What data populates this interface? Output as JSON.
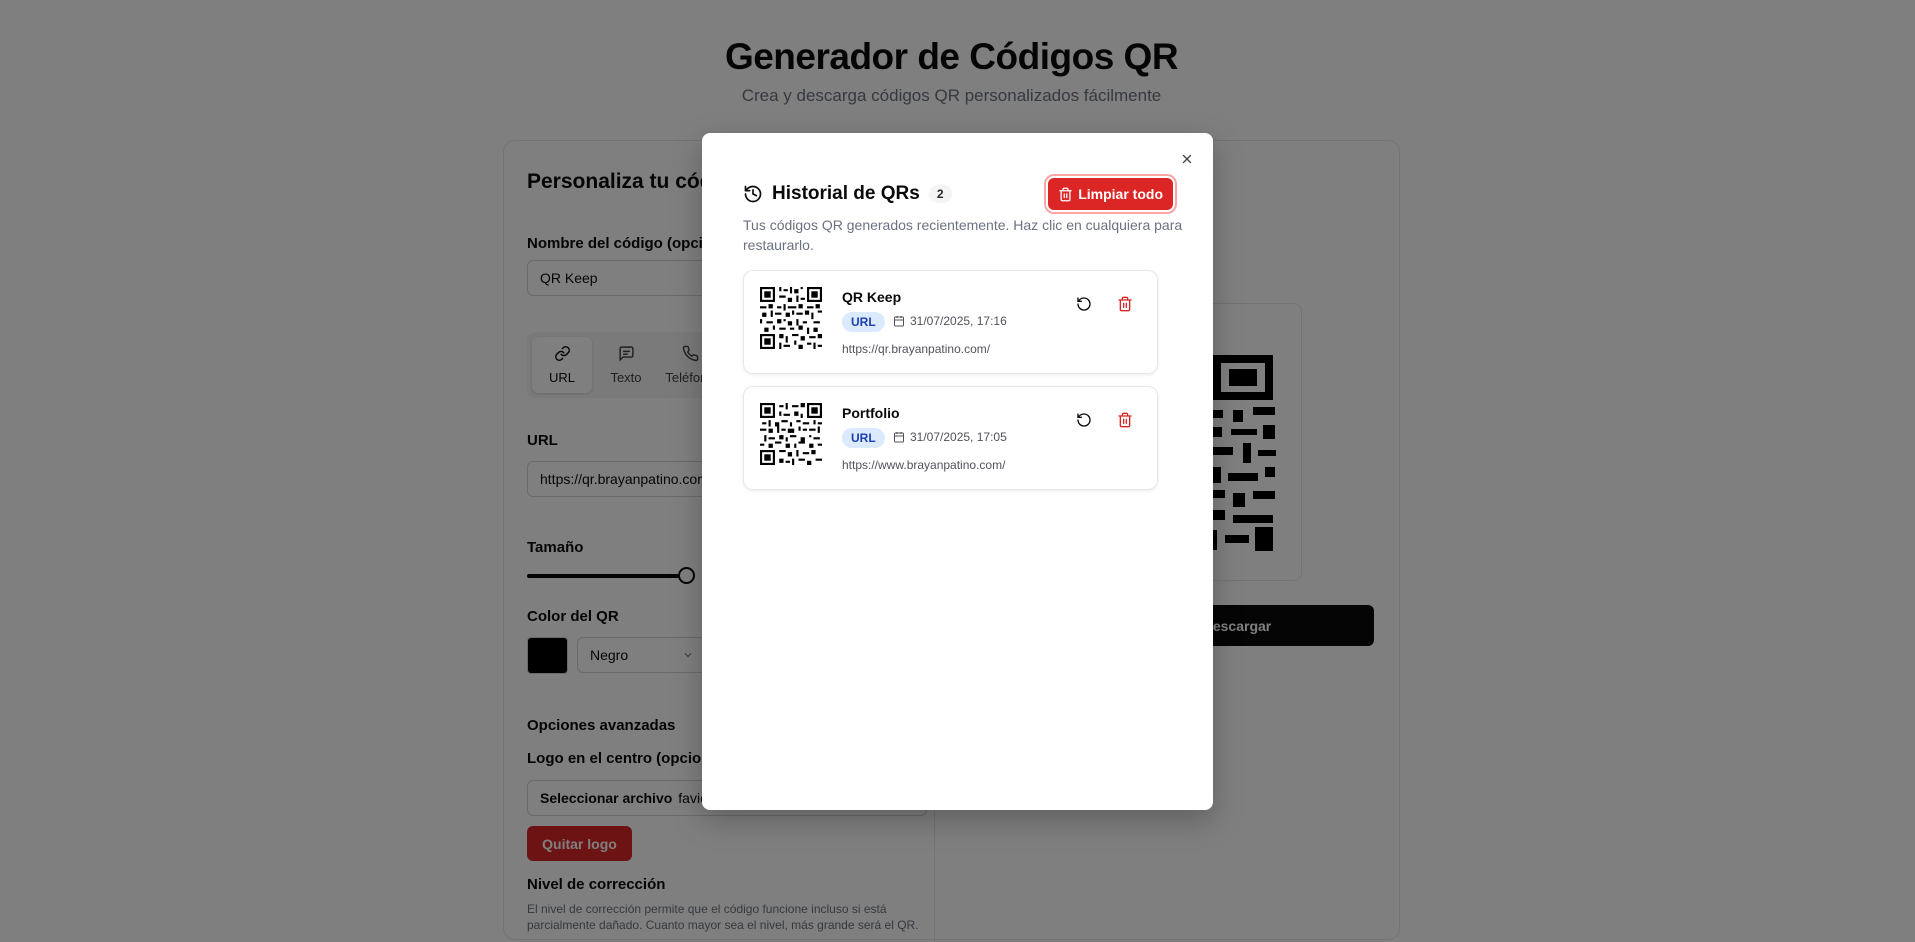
{
  "app": {
    "title": "Generador de Códigos QR",
    "subtitle": "Crea y descarga códigos QR personalizados fácilmente",
    "card_title": "Personaliza tu código",
    "name_label": "Nombre del código (opcional)",
    "name_value": "QR Keep",
    "tabs": [
      {
        "label": "URL",
        "icon": "link-icon"
      },
      {
        "label": "Texto",
        "icon": "message-icon"
      },
      {
        "label": "Teléfono",
        "icon": "phone-icon"
      }
    ],
    "url_label": "URL",
    "url_value": "https://qr.brayanpatino.com/",
    "size_label": "Tamaño",
    "size_fraction": 0.33,
    "color_label": "Color del QR",
    "color_hex": "#000000",
    "color_option": "Negro",
    "advanced_label": "Opciones avanzadas",
    "logo_label": "Logo en el centro (opcional)",
    "file_button": "Seleccionar archivo",
    "file_name": "favicon",
    "remove_logo": "Quitar logo",
    "correction_label": "Nivel de corrección",
    "correction_help": "El nivel de corrección permite que el código funcione incluso si está parcialmente dañado. Cuanto mayor sea el nivel, más grande será el QR.",
    "download_label": "Descargar"
  },
  "modal": {
    "title": "Historial de QRs",
    "count": "2",
    "clear_all": "Limpiar todo",
    "description": "Tus códigos QR generados recientemente. Haz clic en cualquiera para restaurarlo.",
    "items": [
      {
        "name": "QR Keep",
        "type": "URL",
        "date": "31/07/2025, 17:16",
        "url": "https://qr.brayanpatino.com/"
      },
      {
        "name": "Portfolio",
        "type": "URL",
        "date": "31/07/2025, 17:05",
        "url": "https://www.brayanpatino.com/"
      }
    ]
  },
  "colors": {
    "accent_red": "#dc2626",
    "badge_blue_bg": "#dbeafe",
    "badge_blue_text": "#1e40af",
    "overlay": "rgba(0,0,0,0.5)"
  }
}
